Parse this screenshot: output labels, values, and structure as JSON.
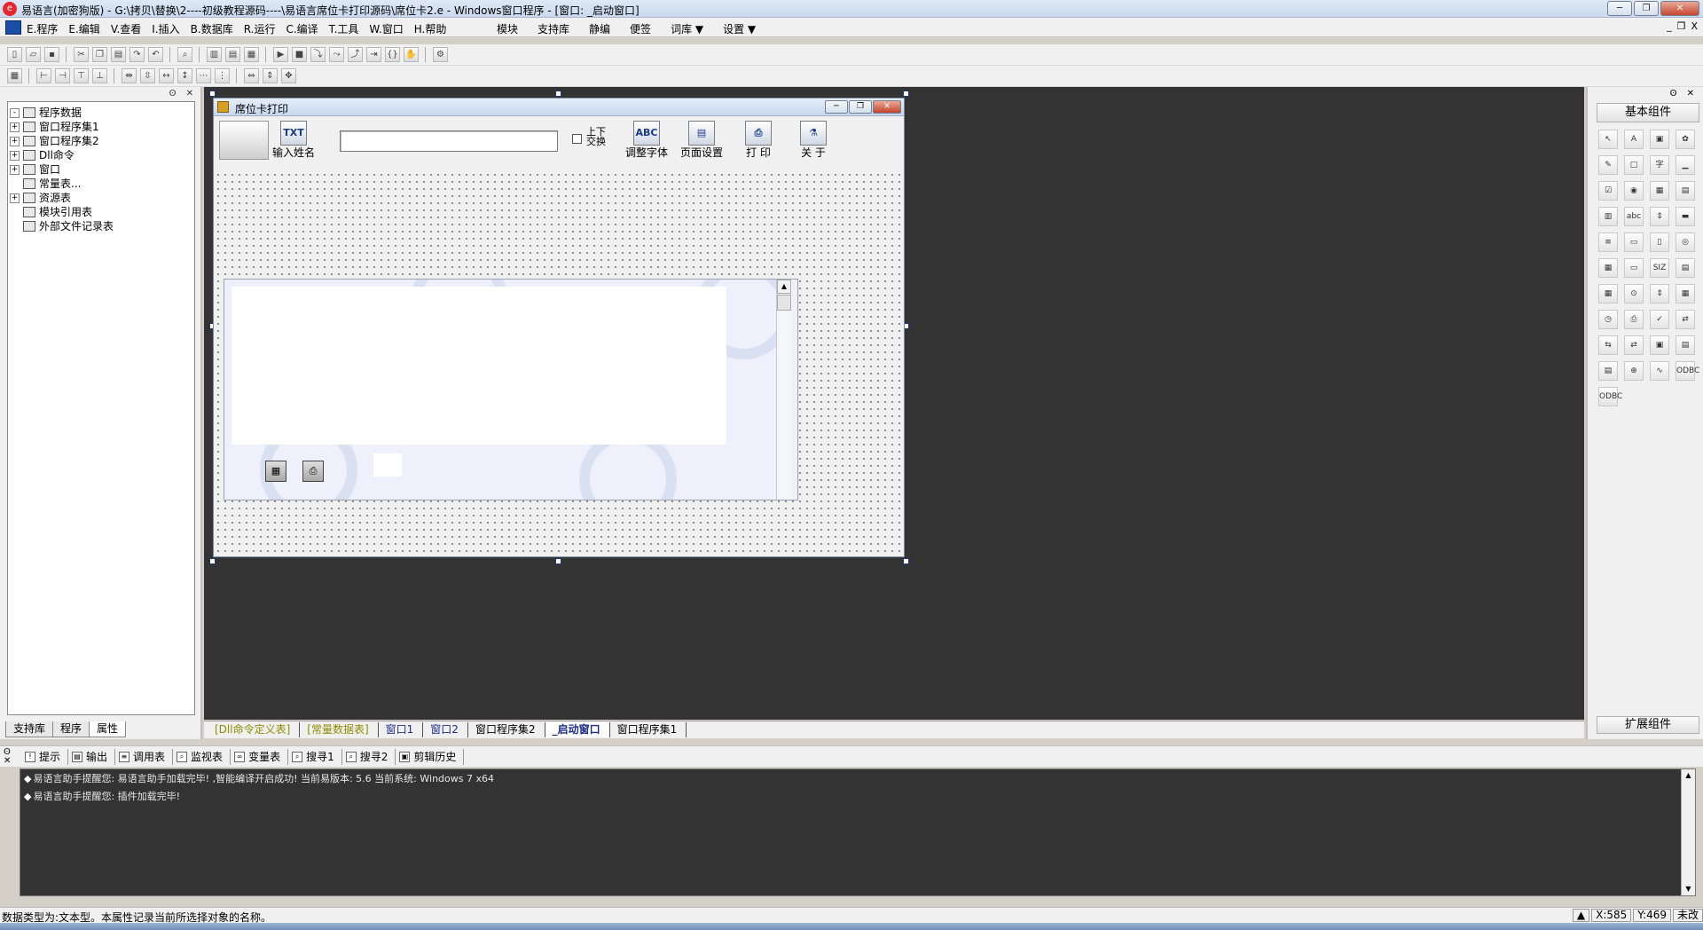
{
  "window": {
    "title": "易语言(加密狗版) - G:\\拷贝\\替换\\2----初级教程源码----\\易语言席位卡打印源码\\席位卡2.e - Windows窗口程序 - [窗口: _启动窗口]",
    "app_icon": "e-logo-icon",
    "controls": [
      "─",
      "❐",
      "✕"
    ]
  },
  "menubar": {
    "items": [
      "E.程序",
      "E.编辑",
      "V.查看",
      "I.插入",
      "B.数据库",
      "R.运行",
      "C.编译",
      "T.工具",
      "W.窗口",
      "H.帮助"
    ],
    "right_items": [
      "模块",
      "支持库",
      "静编",
      "便签",
      "词库 ▼",
      "设置 ▼"
    ],
    "mdi_controls": [
      "_",
      "❐",
      "X"
    ]
  },
  "left_panel": {
    "pin": "ʘ ✕",
    "tree": [
      {
        "label": "程序数据",
        "level": 0,
        "expander": "-",
        "icon": "folder-icon"
      },
      {
        "label": "窗口程序集1",
        "level": 1,
        "expander": "+",
        "icon": "module-icon"
      },
      {
        "label": "窗口程序集2",
        "level": 1,
        "expander": "+",
        "icon": "module-icon"
      },
      {
        "label": "Dll命令",
        "level": 1,
        "expander": "+",
        "icon": "dll-icon"
      },
      {
        "label": "窗口",
        "level": 1,
        "expander": "+",
        "icon": "window-icon"
      },
      {
        "label": "常量表...",
        "level": 1,
        "expander": "",
        "icon": "constant-icon"
      },
      {
        "label": "资源表",
        "level": 1,
        "expander": "+",
        "icon": "resource-icon"
      },
      {
        "label": "模块引用表",
        "level": 1,
        "expander": "",
        "icon": "module-ref-icon"
      },
      {
        "label": "外部文件记录表",
        "level": 1,
        "expander": "",
        "icon": "file-record-icon"
      }
    ],
    "tabs": [
      "支持库",
      "程序",
      "属性"
    ],
    "active_tab": "属性"
  },
  "design_window": {
    "title": "席位卡打印",
    "input_value": "",
    "checkbox_label": "上下交换",
    "tools": [
      {
        "label": "输入姓名",
        "glyph": "TXT"
      },
      {
        "label": "调整字体",
        "glyph": "ABC"
      },
      {
        "label": "页面设置",
        "glyph": "▤"
      },
      {
        "label": "打 印",
        "glyph": "⎙"
      },
      {
        "label": "关 于",
        "glyph": "⚗"
      }
    ]
  },
  "right_panel": {
    "pin": "ʘ ✕",
    "title": "基本组件",
    "footer": "扩展组件",
    "components": [
      "↖",
      "A",
      "▣",
      "✿",
      "✎",
      "□",
      "字",
      "▁",
      "☑",
      "◉",
      "▦",
      "▤",
      "▥",
      "abc",
      "⇕",
      "▬",
      "≡",
      "▭",
      "▯",
      "◎",
      "▦",
      "▭",
      "SIZ",
      "▤",
      "▦",
      "⊙",
      "⇕",
      "▦",
      "◷",
      "⎙",
      "✓",
      "⇄",
      "⇆",
      "⇄",
      "▣",
      "▤",
      "▤",
      "⊕",
      "∿",
      "ODBC",
      "ODBC"
    ]
  },
  "doc_tabs": [
    {
      "label": "[Dll命令定义表]",
      "style": "olive"
    },
    {
      "label": "[常量数据表]",
      "style": "olive"
    },
    {
      "label": "窗口1",
      "style": "navy"
    },
    {
      "label": "窗口2",
      "style": "navy"
    },
    {
      "label": "窗口程序集2",
      "style": ""
    },
    {
      "label": "_启动窗口",
      "style": "active"
    },
    {
      "label": "窗口程序集1",
      "style": ""
    }
  ],
  "bottom_tabs": [
    "提示",
    "输出",
    "调用表",
    "监视表",
    "变量表",
    "搜寻1",
    "搜寻2",
    "剪辑历史"
  ],
  "output_lines": [
    "易语言助手提醒您: 易语言助手加载完毕! ,智能编译开启成功! 当前易版本: 5.6 当前系统: Windows 7 x64",
    "易语言助手提醒您: 插件加载完毕!"
  ],
  "status": {
    "text": "数据类型为:文本型。本属性记录当前所选择对象的名称。",
    "x": "X:585",
    "y": "Y:469",
    "mode": "未改"
  }
}
